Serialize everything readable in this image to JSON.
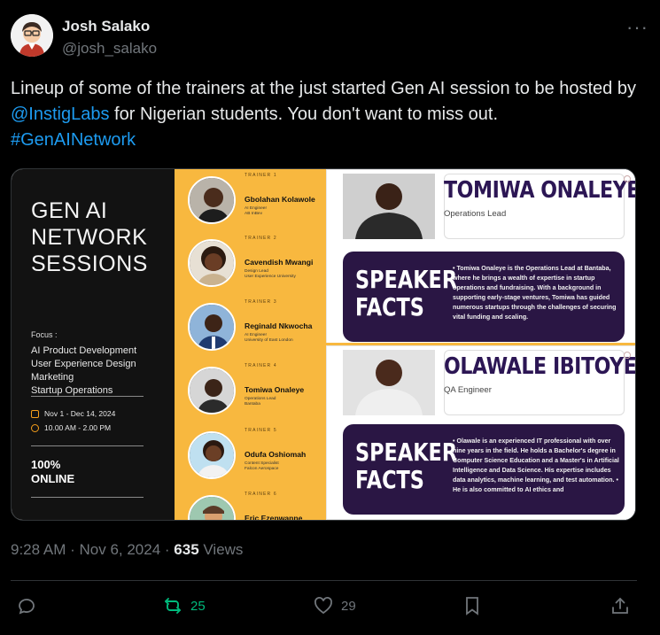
{
  "author": {
    "name": "Josh Salako",
    "handle": "@josh_salako",
    "more_icon": "ellipsis-icon"
  },
  "tweet": {
    "text_before_mention": "Lineup of some of the trainers at the just started Gen AI session to be hosted by ",
    "mention": "@InstigLabs",
    "text_after_mention": " for Nigerian students. You don't want to miss out.",
    "hashtag": "#GenAINetwork"
  },
  "media": {
    "panel1": {
      "title_lines": [
        "GEN AI",
        "NETWORK",
        "SESSIONS"
      ],
      "focus_label": "Focus :",
      "focus_items": [
        "AI Product Development",
        "User Experience Design",
        "Marketing",
        "Startup Operations"
      ],
      "dates": "Nov 1 - Dec 14, 2024",
      "time": "10.00 AM - 2.00 PM",
      "online_lines": [
        "100%",
        "ONLINE"
      ]
    },
    "trainers": [
      {
        "num": "TRAINER 1",
        "name": "Gbolahan Kolawole",
        "role": "AI Engineer",
        "org": "AB InBev"
      },
      {
        "num": "TRAINER 2",
        "name": "Cavendish Mwangi",
        "role": "Design Lead",
        "org": "User Experience University"
      },
      {
        "num": "TRAINER 3",
        "name": "Reginald Nkwocha",
        "role": "AI Engineer",
        "org": "University of East London"
      },
      {
        "num": "TRAINER 4",
        "name": "Tomiwa Onaleye",
        "role": "Operations Lead",
        "org": "Bantaba"
      },
      {
        "num": "TRAINER 5",
        "name": "Odufa Oshiomah",
        "role": "Content Specialist",
        "org": "Falcon Aerospace"
      },
      {
        "num": "TRAINER 6",
        "name": "Eric Ezenwanne",
        "role": "",
        "org": ""
      }
    ],
    "speakers": [
      {
        "name": "TOMIWA ONALEYE",
        "role": "Operations Lead",
        "facts_title_1": "SPEAKER",
        "facts_title_2": "FACTS",
        "facts": "• Tomiwa Onaleye is the Operations Lead at Bantaba, where he brings a wealth of expertise in startup operations and fundraising. With a background in supporting early-stage ventures, Tomiwa has guided numerous startups through the challenges of securing vital funding and scaling."
      },
      {
        "name": "OLAWALE IBITOYE",
        "role": "QA Engineer",
        "facts_title_1": "SPEAKER",
        "facts_title_2": "FACTS",
        "facts": "• Olawale is an experienced IT professional with over nine years in the field. He holds a Bachelor's degree in Computer Science Education and a Master's in Artificial Intelligence and Data Science. His expertise includes data analytics, machine learning, and test automation. • He is also committed to AI ethics and"
      }
    ]
  },
  "meta": {
    "time": "9:28 AM",
    "sep1": " · ",
    "date": "Nov 6, 2024",
    "sep2": " · ",
    "views_count": "635",
    "views_label": " Views"
  },
  "actions": {
    "reply_count": "",
    "repost_count": "25",
    "like_count": "29",
    "repost_color": "#00ba7c"
  }
}
